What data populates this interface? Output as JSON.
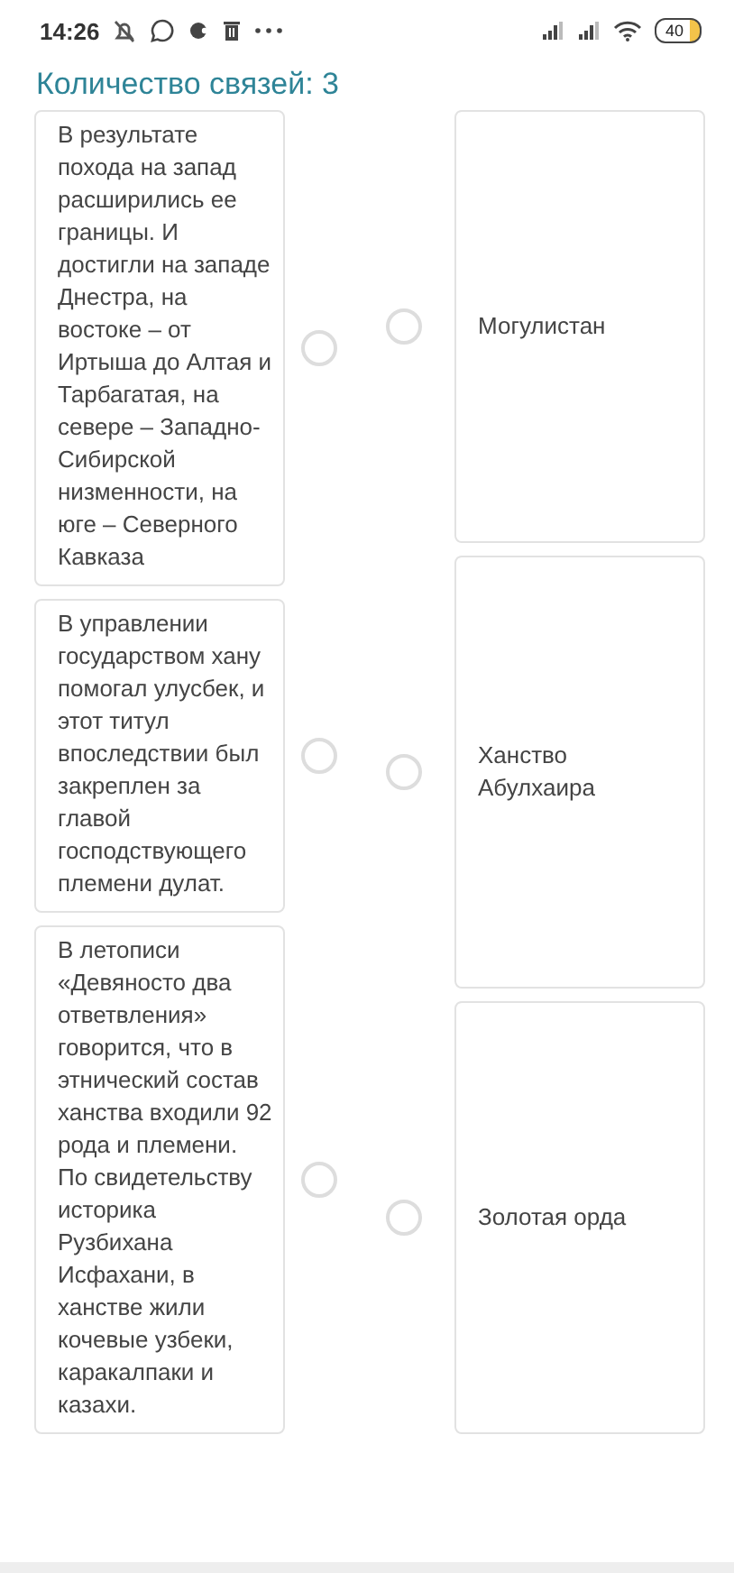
{
  "status_bar": {
    "time": "14:26",
    "battery": "40"
  },
  "title": "Количество связей: 3",
  "left_items": [
    {
      "text": "В результате похода на запад расширились ее границы. И достигли на западе Днестра, на востоке – от Иртыша до Алтая и Тарбагатая, на севере – Западно-Сибирской низменности, на юге – Северного Кавказа"
    },
    {
      "text": "В управлении государством хану помогал улусбек, и этот титул впоследствии был закреплен за главой господствующего племени дулат."
    },
    {
      "text": "В летописи «Девяносто два ответвления» говорится, что в этнический состав ханства входили 92 рода и племени. По свидетельству историка Рузбихана Исфахани, в ханстве жили кочевые узбеки, каракалпаки и казахи."
    }
  ],
  "right_items": [
    {
      "text": "Могулистан"
    },
    {
      "text": "Ханство Абулхаира"
    },
    {
      "text": "Золотая орда"
    }
  ]
}
